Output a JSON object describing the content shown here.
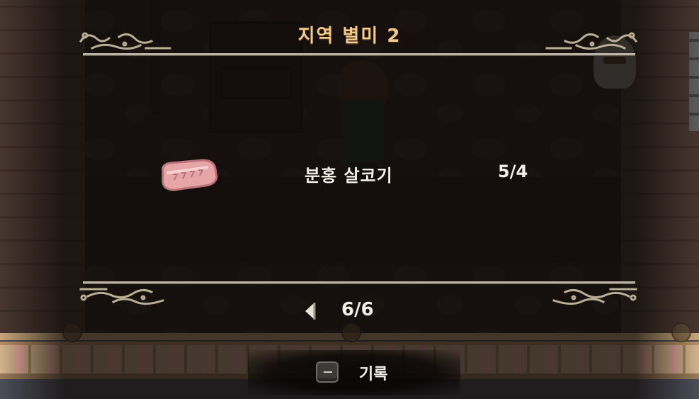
{
  "screen": {
    "title": "지역 별미 2",
    "item": {
      "name": "분홍 살코기",
      "count": "5/4",
      "icon": "pink-meat-icon"
    },
    "pager": {
      "current": "6/6",
      "prev_icon": "arrow-left-icon"
    },
    "hint": {
      "key_icon": "keyboard-key-icon",
      "label": "기록"
    }
  },
  "colors": {
    "title": "#f1c98a",
    "text": "#f2efe8",
    "rule": "#bdb4a8",
    "flourish": "#b9ad93",
    "meat": "#e8a5a8"
  }
}
